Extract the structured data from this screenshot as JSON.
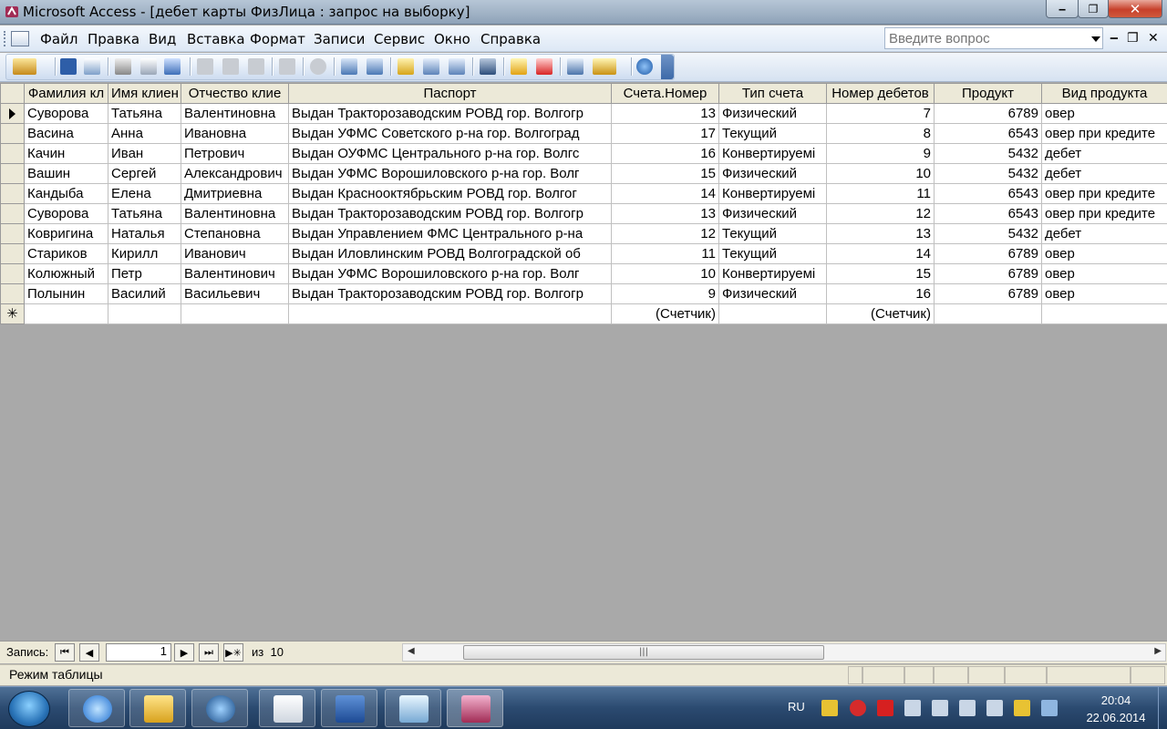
{
  "window": {
    "title": "Microsoft Access - [дебет карты ФизЛица : запрос на выборку]"
  },
  "menu": {
    "items": [
      "Файл",
      "Правка",
      "Вид",
      "Вставка",
      "Формат",
      "Записи",
      "Сервис",
      "Окно",
      "Справка"
    ],
    "ask_placeholder": "Введите вопрос"
  },
  "toolbar": {
    "icons": [
      "design-view-icon",
      "save-icon",
      "file-search-icon",
      "print-icon",
      "print-preview-icon",
      "spelling-icon",
      "cut-icon",
      "copy-icon",
      "paste-icon",
      "undo-icon",
      "hyperlink-icon",
      "sort-ascending-icon",
      "sort-descending-icon",
      "filter-by-selection-icon",
      "filter-by-form-icon",
      "apply-filter-icon",
      "find-icon",
      "new-record-icon",
      "delete-record-icon",
      "database-window-icon",
      "new-object-icon",
      "help-icon"
    ]
  },
  "datasheet": {
    "columns": [
      "Фамилия кл",
      "Имя клиен",
      "Отчество клие",
      "Паспорт",
      "Счета.Номер",
      "Тип счета",
      "Номер дебетов",
      "Продукт",
      "Вид продукта"
    ],
    "rows": [
      [
        "Суворова",
        "Татьяна",
        "Валентиновна",
        "Выдан Тракторозаводским РОВД гор. Волгогр",
        "13",
        "Физический",
        "7",
        "6789",
        "овер"
      ],
      [
        "Васина",
        "Анна",
        "Ивановна",
        "Выдан УФМС Советского р-на  гор. Волгоград",
        "17",
        "Текущий",
        "8",
        "6543",
        "овер при кредите"
      ],
      [
        "Качин",
        "Иван",
        "Петрович",
        "Выдан ОУФМС Центрального р-на гор. Волгс",
        "16",
        "Конвертируемі",
        "9",
        "5432",
        "дебет"
      ],
      [
        "Вашин",
        "Сергей",
        "Александрович",
        "Выдан УФМС Ворошиловского р-на гор. Волг",
        "15",
        "Физический",
        "10",
        "5432",
        "дебет"
      ],
      [
        "Кандыба",
        "Елена",
        "Дмитриевна",
        "Выдан Краснооктябрьским РОВД гор. Волгог",
        "14",
        "Конвертируемі",
        "11",
        "6543",
        "овер при кредите"
      ],
      [
        "Суворова",
        "Татьяна",
        "Валентиновна",
        "Выдан Тракторозаводским РОВД гор. Волгогр",
        "13",
        "Физический",
        "12",
        "6543",
        "овер при кредите"
      ],
      [
        "Ковригина",
        "Наталья",
        "Степановна",
        "Выдан Управлением ФМС Центрального р-на",
        "12",
        "Текущий",
        "13",
        "5432",
        "дебет"
      ],
      [
        "Стариков",
        "Кирилл",
        "Иванович",
        "Выдан Иловлинским РОВД Волгоградской об",
        "11",
        "Текущий",
        "14",
        "6789",
        "овер"
      ],
      [
        "Колюжный",
        "Петр",
        "Валентинович",
        "Выдан УФМС Ворошиловского р-на гор. Волг",
        "10",
        "Конвертируемі",
        "15",
        "6789",
        "овер"
      ],
      [
        "Полынин",
        "Василий",
        "Васильевич",
        "Выдан Тракторозаводским РОВД гор. Волгогр",
        "9",
        "Физический",
        "16",
        "6789",
        "овер"
      ]
    ],
    "new_row": [
      "",
      "",
      "",
      "",
      "(Счетчик)",
      "",
      "(Счетчик)",
      "",
      ""
    ],
    "new_row_marker": "✳"
  },
  "navigation": {
    "label": "Запись:",
    "current": "1",
    "of_label": "из",
    "total": "10"
  },
  "status": {
    "text": "Режим таблицы"
  },
  "taskbar": {
    "apps": [
      "internet-explorer-icon",
      "explorer-folder-icon",
      "media-player-icon",
      "calendar-icon",
      "word-icon",
      "notepad-icon",
      "access-icon"
    ],
    "lang": "RU",
    "time": "20:04",
    "date": "22.06.2014"
  }
}
